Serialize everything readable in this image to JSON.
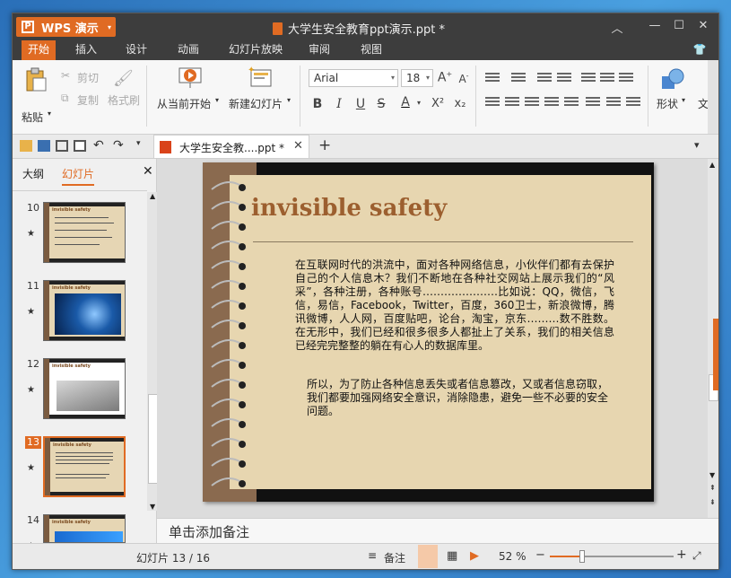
{
  "app": {
    "name": "WPS 演示",
    "window_title": "大学生安全教育ppt演示.ppt *",
    "accent_color": "#e06b23"
  },
  "menu_tabs": [
    "开始",
    "插入",
    "设计",
    "动画",
    "幻灯片放映",
    "审阅",
    "视图"
  ],
  "ribbon": {
    "paste": "粘贴",
    "cut": "剪切",
    "copy": "复制",
    "format_painter": "格式刷",
    "from_current": "从当前开始",
    "new_slide": "新建幻灯片",
    "font_name": "Arial",
    "font_size": "18",
    "shape": "形状",
    "more": "文"
  },
  "doc_tab": {
    "name": "大学生安全教....ppt *"
  },
  "left_pane": {
    "tab_outline": "大纲",
    "tab_slides": "幻灯片",
    "thumbnails": [
      {
        "num": "10",
        "title": "invisible safety"
      },
      {
        "num": "11",
        "title": "invisible safety"
      },
      {
        "num": "12",
        "title": "invisible safety"
      },
      {
        "num": "13",
        "title": "invisible safety"
      },
      {
        "num": "14",
        "title": "invisible safety"
      }
    ]
  },
  "slide": {
    "title": "invisible safety",
    "para1": "在互联网时代的洪流中，面对各种网络信息，小伙伴们都有去保护自己的个人信息木？我们不断地在各种社交网站上展示我们的“风采”，各种注册，各种账号…………………比如说：QQ，微信，飞信，易信，Facebook，Twitter，百度，360卫士，新浪微博，腾讯微博，人人网，百度贴吧，论台，淘宝，京东………数不胜数。在无形中，我们已经和很多很多人都扯上了关系，我们的相关信息已经完完整整的躺在有心人的数据库里。",
    "para2": "所以，为了防止各种信息丢失或者信息篡改，又或者信息窃取，我们都要加强网络安全意识，消除隐患，避免一些不必要的安全问题。"
  },
  "notes_placeholder": "单击添加备注",
  "status": {
    "slide_counter": "幻灯片 13 / 16",
    "notes_btn": "备注",
    "zoom": "52 %",
    "zoom_level": 0.52
  }
}
